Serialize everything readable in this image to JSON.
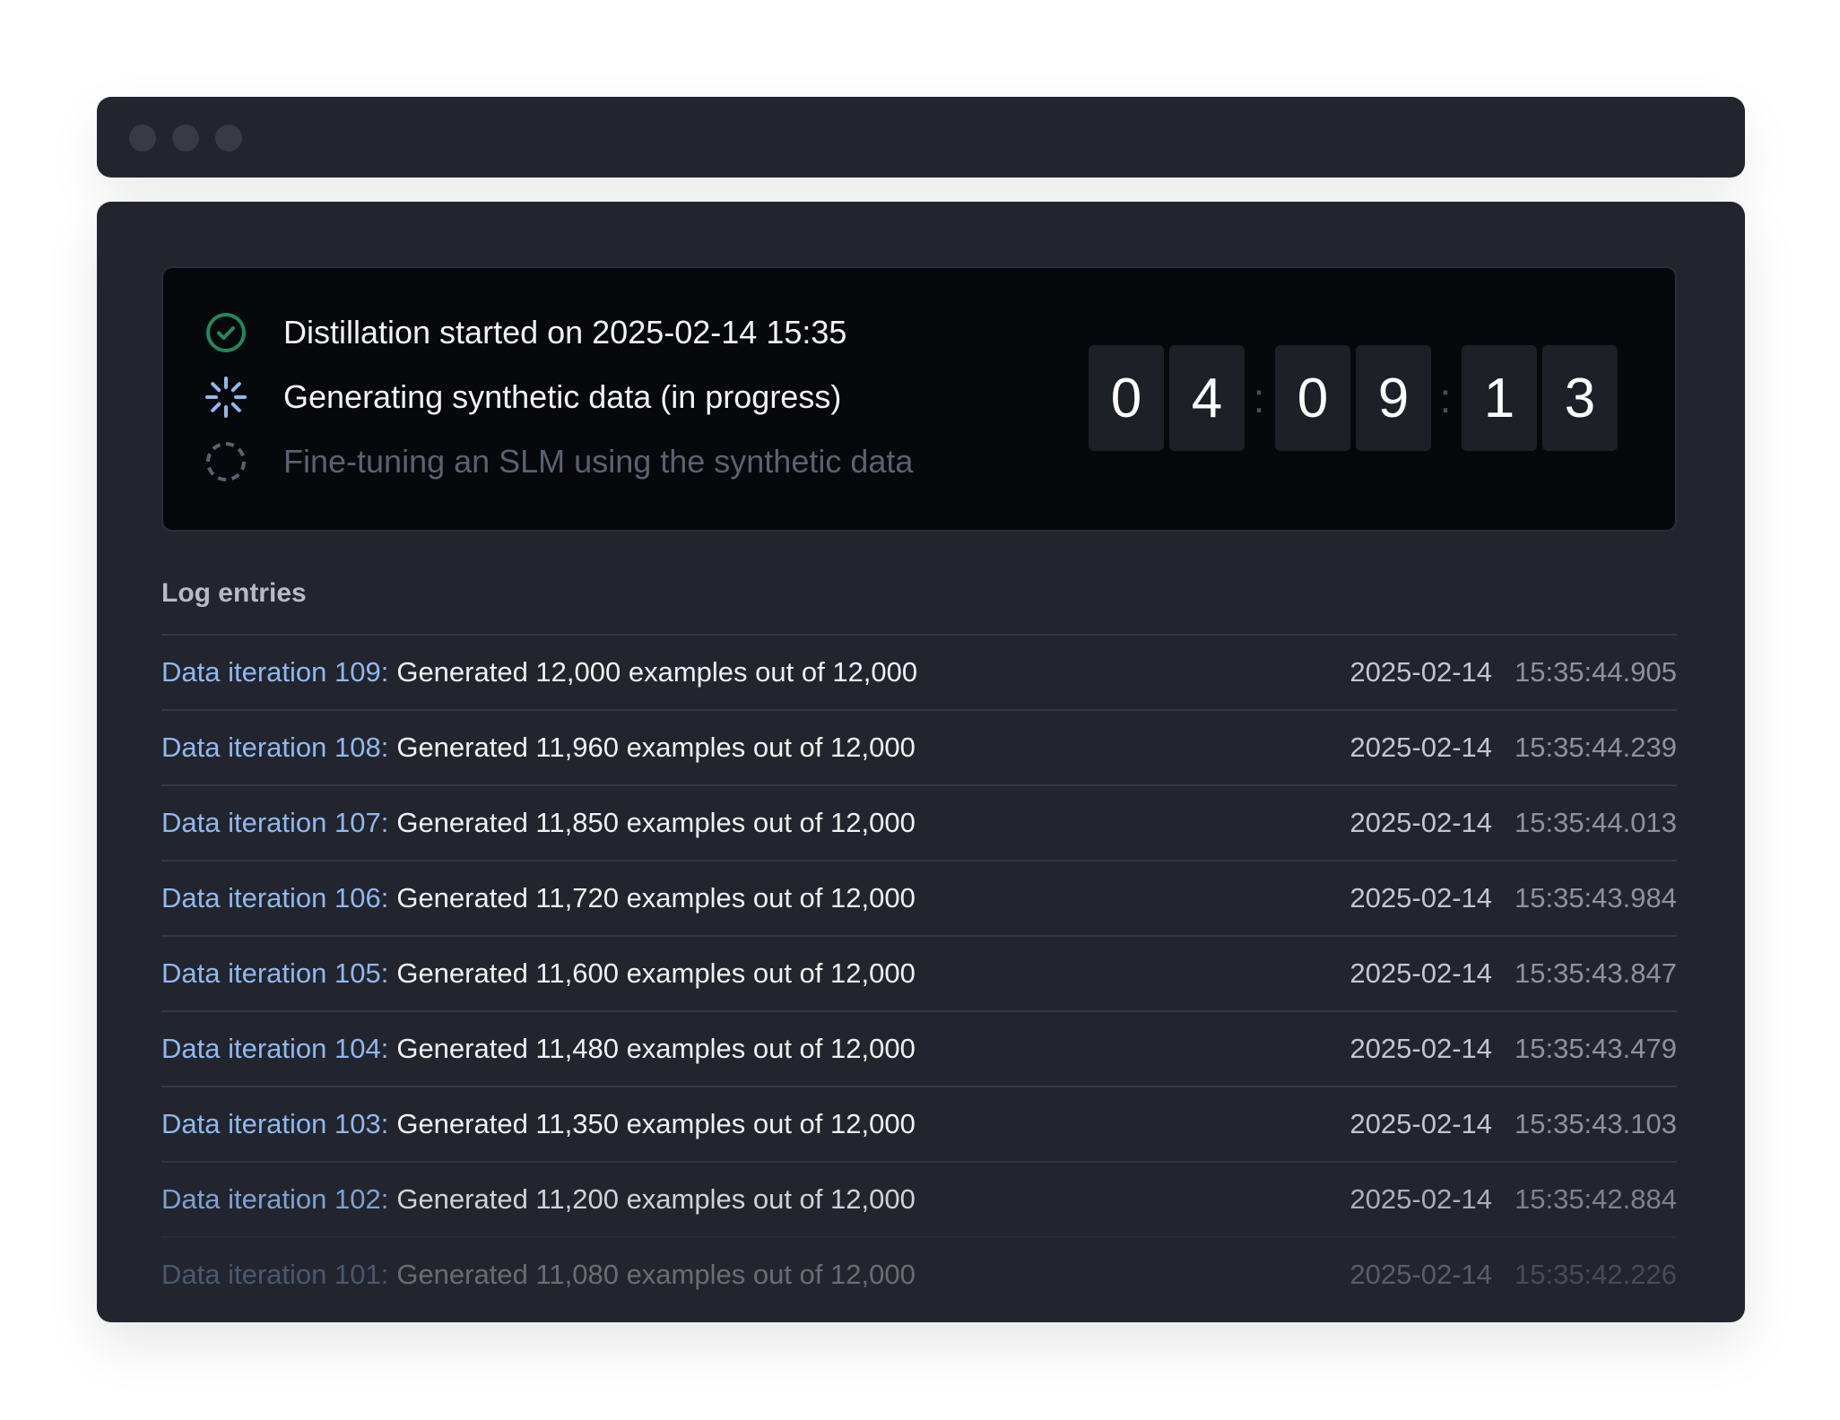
{
  "window": {
    "traffic_lights": [
      "close",
      "minimize",
      "maximize"
    ]
  },
  "status": {
    "steps": [
      {
        "label": "Distillation started on 2025-02-14 15:35",
        "state": "completed",
        "icon": "check-circle-icon"
      },
      {
        "label": "Generating synthetic data (in progress)",
        "state": "in-progress",
        "icon": "spinner-icon"
      },
      {
        "label": "Fine-tuning an SLM using the synthetic data",
        "state": "pending",
        "icon": "dashed-circle-icon"
      }
    ],
    "timer": {
      "hours": [
        "0",
        "4"
      ],
      "minutes": [
        "0",
        "9"
      ],
      "seconds": [
        "1",
        "3"
      ],
      "separator": ":"
    }
  },
  "log": {
    "title": "Log entries",
    "entries": [
      {
        "iteration": "Data iteration 109:",
        "message": "Generated 12,000 examples out of 12,000",
        "date": "2025-02-14",
        "time": "15:35:44.905"
      },
      {
        "iteration": "Data iteration 108:",
        "message": "Generated 11,960 examples out of 12,000",
        "date": "2025-02-14",
        "time": "15:35:44.239"
      },
      {
        "iteration": "Data iteration 107:",
        "message": "Generated 11,850 examples out of 12,000",
        "date": "2025-02-14",
        "time": "15:35:44.013"
      },
      {
        "iteration": "Data iteration 106:",
        "message": "Generated 11,720 examples out of 12,000",
        "date": "2025-02-14",
        "time": "15:35:43.984"
      },
      {
        "iteration": "Data iteration 105:",
        "message": "Generated 11,600 examples out of 12,000",
        "date": "2025-02-14",
        "time": "15:35:43.847"
      },
      {
        "iteration": "Data iteration 104:",
        "message": "Generated 11,480 examples out of 12,000",
        "date": "2025-02-14",
        "time": "15:35:43.479"
      },
      {
        "iteration": "Data iteration 103:",
        "message": "Generated 11,350 examples out of 12,000",
        "date": "2025-02-14",
        "time": "15:35:43.103"
      },
      {
        "iteration": "Data iteration 102:",
        "message": "Generated 11,200 examples out of 12,000",
        "date": "2025-02-14",
        "time": "15:35:42.884"
      },
      {
        "iteration": "Data iteration 101:",
        "message": "Generated 11,080 examples out of 12,000",
        "date": "2025-02-14",
        "time": "15:35:42.226"
      }
    ]
  },
  "colors": {
    "completed": "#1f8a5b",
    "in_progress": "#8fb8ef",
    "pending": "#5b6170",
    "iteration_link": "#8fb8ef"
  }
}
